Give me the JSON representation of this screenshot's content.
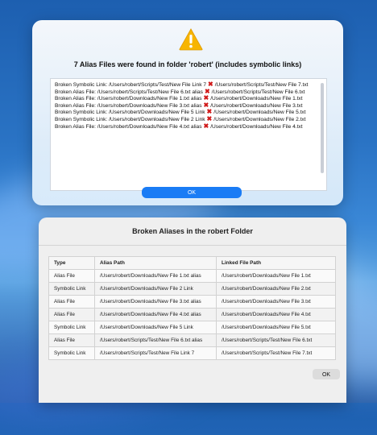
{
  "alert": {
    "title": "7 Alias Files were found in folder 'robert' (includes symbolic links)",
    "icon": "warning-icon",
    "lines": [
      {
        "prefix": "Broken Symbolic Link:  /Users/robert/Scripts/Test/New File Link 7",
        "target": "/Users/robert/Scripts/Test/New File 7.txt"
      },
      {
        "prefix": "Broken Alias File:  /Users/robert/Scripts/Test/New File 6.txt alias",
        "target": "/Users/robert/Scripts/Test/New File 6.txt"
      },
      {
        "prefix": "Broken Alias File:  /Users/robert/Downloads/New File 1.txt alias",
        "target": "/Users/robert/Downloads/New File 1.txt"
      },
      {
        "prefix": "Broken Alias File:  /Users/robert/Downloads/New File 3.txt alias",
        "target": "/Users/robert/Downloads/New File 3.txt"
      },
      {
        "prefix": "Broken Symbolic Link:  /Users/robert/Downloads/New File 5 Link",
        "target": "/Users/robert/Downloads/New File 5.txt"
      },
      {
        "prefix": "Broken Symbolic Link:  /Users/robert/Downloads/New File 2 Link",
        "target": "/Users/robert/Downloads/New File 2.txt"
      },
      {
        "prefix": "Broken Alias File:  /Users/robert/Downloads/New File 4.txt alias",
        "target": "/Users/robert/Downloads/New File 4.txt"
      }
    ],
    "ok_label": "OK"
  },
  "window": {
    "title": "Broken Aliases in the robert Folder",
    "headers": [
      "Type",
      "Alias Path",
      "Linked File Path"
    ],
    "rows": [
      [
        "Alias File",
        "/Users/robert/Downloads/New File 1.txt alias",
        "/Users/robert/Downloads/New File 1.txt"
      ],
      [
        "Symbolic Link",
        "/Users/robert/Downloads/New File 2 Link",
        "/Users/robert/Downloads/New File 2.txt"
      ],
      [
        "Alias File",
        "/Users/robert/Downloads/New File 3.txt alias",
        "/Users/robert/Downloads/New File 3.txt"
      ],
      [
        "Alias File",
        "/Users/robert/Downloads/New File 4.txt alias",
        "/Users/robert/Downloads/New File 4.txt"
      ],
      [
        "Symbolic Link",
        "/Users/robert/Downloads/New File 5 Link",
        "/Users/robert/Downloads/New File 5.txt"
      ],
      [
        "Alias File",
        "/Users/robert/Scripts/Test/New File 6.txt alias",
        "/Users/robert/Scripts/Test/New File 6.txt"
      ],
      [
        "Symbolic Link",
        "/Users/robert/Scripts/Test/New File Link 7",
        "/Users/robert/Scripts/Test/New File 7.txt"
      ]
    ],
    "ok_label": "OK"
  },
  "colors": {
    "accent": "#1a7cf5",
    "broken_mark": "#d01818",
    "warning_fill": "#f7b500"
  }
}
